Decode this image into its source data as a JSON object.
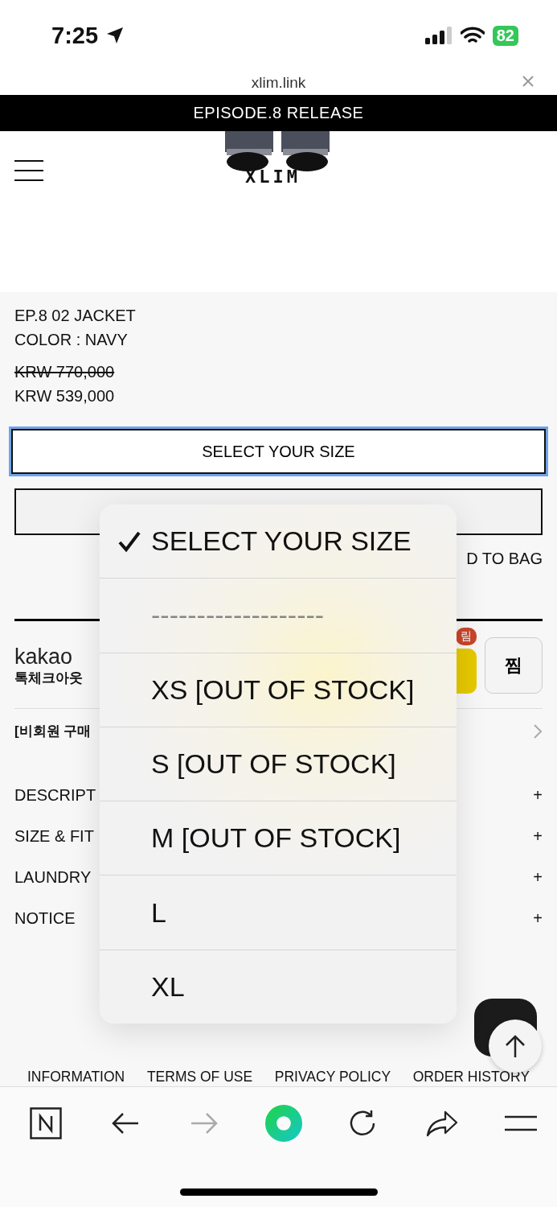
{
  "status_bar": {
    "time": "7:25",
    "battery": "82"
  },
  "browser": {
    "url": "xlim.link"
  },
  "banner": "EPISODE.8 RELEASE",
  "header": {
    "logo": "XLIM"
  },
  "product": {
    "name": "EP.8 02 JACKET",
    "color_line": "COLOR : NAVY",
    "original_price": "KRW 770,000",
    "price": "KRW 539,000"
  },
  "size_select": {
    "value": "SELECT YOUR SIZE",
    "focused": true
  },
  "add_to_bag": "D TO BAG",
  "kakao": {
    "brand": "kakao",
    "subtitle": "톡체크아웃",
    "badge": "림",
    "wish": "찜"
  },
  "guest_purchase": "[비회원 구매",
  "sections": [
    {
      "label": "DESCRIPT",
      "toggle": "+"
    },
    {
      "label": "SIZE & FIT",
      "toggle": "+"
    },
    {
      "label": "LAUNDRY",
      "toggle": "+"
    },
    {
      "label": "NOTICE",
      "toggle": "+"
    }
  ],
  "dropdown": [
    {
      "label": "SELECT YOUR SIZE",
      "selected": true,
      "disabled": false
    },
    {
      "label": "-------------------",
      "selected": false,
      "disabled": true
    },
    {
      "label": "XS [OUT OF STOCK]",
      "selected": false,
      "disabled": false
    },
    {
      "label": "S [OUT OF STOCK]",
      "selected": false,
      "disabled": false
    },
    {
      "label": "M [OUT OF STOCK]",
      "selected": false,
      "disabled": false
    },
    {
      "label": "L",
      "selected": false,
      "disabled": false
    },
    {
      "label": "XL",
      "selected": false,
      "disabled": false
    }
  ],
  "footer_links": [
    "INFORMATION",
    "TERMS OF USE",
    "PRIVACY POLICY",
    "ORDER HISTORY"
  ],
  "toolbar": [
    {
      "kind": "home",
      "disabled": false
    },
    {
      "kind": "back",
      "disabled": false
    },
    {
      "kind": "forward",
      "disabled": true
    },
    {
      "kind": "green",
      "disabled": false
    },
    {
      "kind": "reload",
      "disabled": false
    },
    {
      "kind": "share",
      "disabled": false
    },
    {
      "kind": "menu",
      "disabled": false
    }
  ]
}
